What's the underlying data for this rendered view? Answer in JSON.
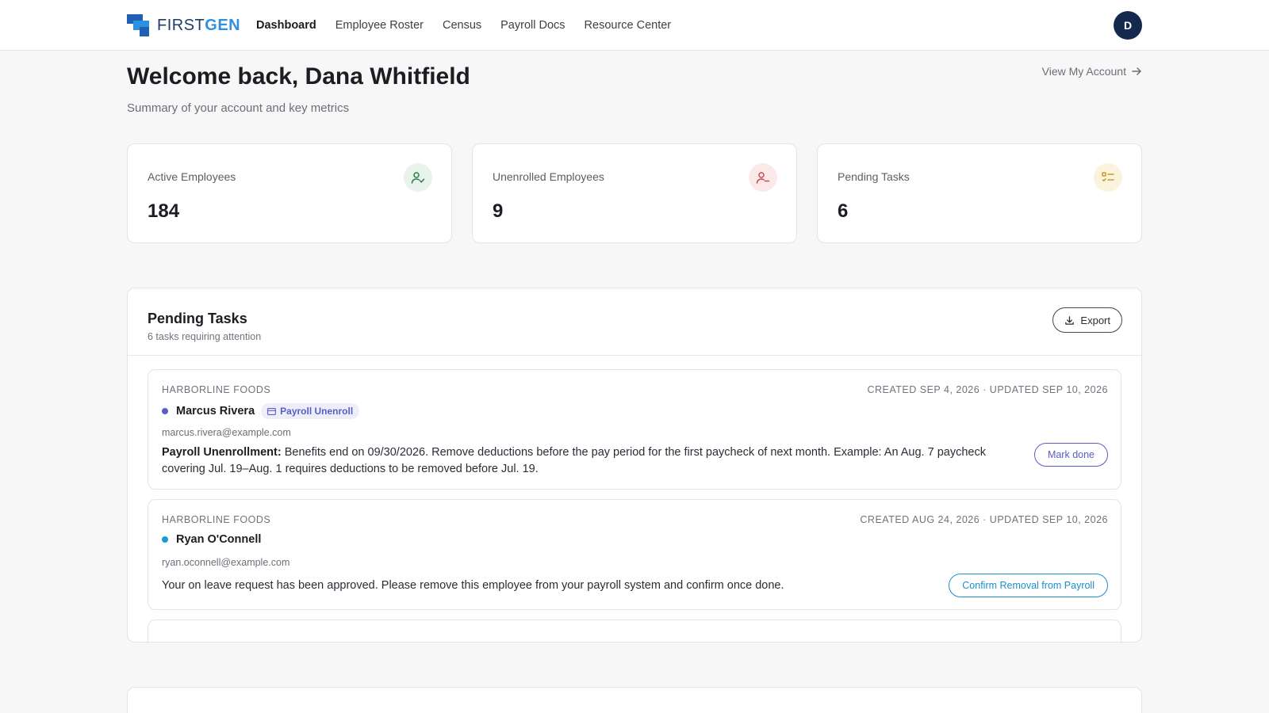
{
  "app": {
    "logo_part1": "FIRST",
    "logo_part2": "GEN",
    "user_initial": "D"
  },
  "nav": {
    "items": [
      {
        "label": "Dashboard",
        "active": true
      },
      {
        "label": "Employee Roster",
        "active": false
      },
      {
        "label": "Census",
        "active": false
      },
      {
        "label": "Payroll Docs",
        "active": false
      },
      {
        "label": "Resource Center",
        "active": false
      }
    ]
  },
  "header": {
    "title": "Welcome back, Dana Whitfield",
    "subtitle": "Summary of your account and key metrics",
    "view_account": "View My Account"
  },
  "stats": [
    {
      "label": "Active Employees",
      "value": "184",
      "icon": "user-check-icon",
      "color": "#2f7a4a"
    },
    {
      "label": "Unenrolled Employees",
      "value": "9",
      "icon": "user-minus-icon",
      "color": "#c84a52"
    },
    {
      "label": "Pending Tasks",
      "value": "6",
      "icon": "task-list-icon",
      "color": "#c99a2a"
    }
  ],
  "tasks_panel": {
    "title": "Pending Tasks",
    "subtitle": "6 tasks requiring attention",
    "export_label": "Export",
    "tasks": [
      {
        "company": "HARBORLINE FOODS",
        "dates": "CREATED SEP 4, 2026 · UPDATED SEP 10, 2026",
        "name": "Marcus Rivera",
        "dot_color": "#5a5dc4",
        "tag": "Payroll Unenroll",
        "email": "marcus.rivera@example.com",
        "desc_bold": "Payroll Unenrollment:",
        "desc": "Benefits end on 09/30/2026. Remove deductions before the pay period for the first paycheck of next month. Example: An Aug. 7 paycheck covering Jul. 19–Aug. 1 requires deductions to be removed before Jul. 19.",
        "action": "Mark done"
      },
      {
        "company": "HARBORLINE FOODS",
        "dates": "CREATED AUG 24, 2026 · UPDATED SEP 10, 2026",
        "name": "Ryan O'Connell",
        "dot_color": "#1c9ad6",
        "email": "ryan.oconnell@example.com",
        "desc": "Your on leave request has been approved. Please remove this employee from your payroll system and confirm once done.",
        "action": "Confirm Removal from Payroll"
      }
    ]
  }
}
